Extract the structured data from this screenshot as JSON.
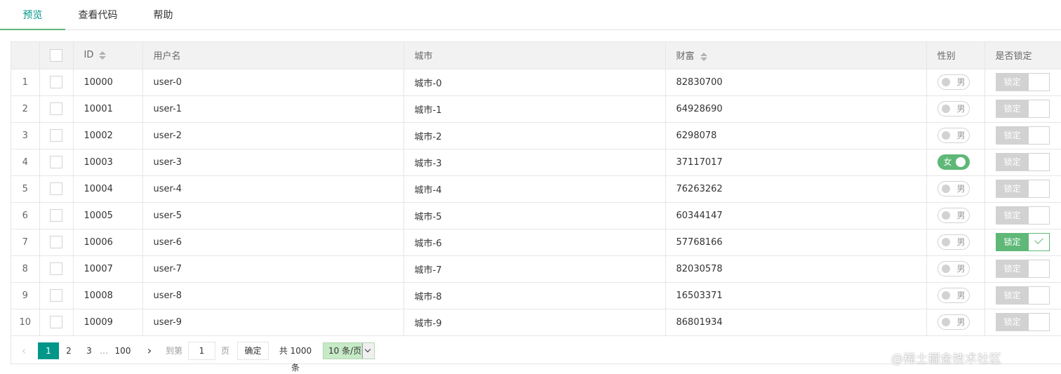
{
  "tabs": [
    {
      "label": "预览",
      "active": true
    },
    {
      "label": "查看代码",
      "active": false
    },
    {
      "label": "帮助",
      "active": false
    }
  ],
  "table": {
    "columns": {
      "id": "ID",
      "username": "用户名",
      "city": "城市",
      "wealth": "财富",
      "gender": "性别",
      "locked": "是否锁定"
    },
    "rows": [
      {
        "no": "1",
        "id": "10000",
        "username": "user-0",
        "city": "城市-0",
        "wealth": "82830700",
        "gender": "男",
        "gender_on": false,
        "lock_label": "锁定",
        "locked": false
      },
      {
        "no": "2",
        "id": "10001",
        "username": "user-1",
        "city": "城市-1",
        "wealth": "64928690",
        "gender": "男",
        "gender_on": false,
        "lock_label": "锁定",
        "locked": false
      },
      {
        "no": "3",
        "id": "10002",
        "username": "user-2",
        "city": "城市-2",
        "wealth": "6298078",
        "gender": "男",
        "gender_on": false,
        "lock_label": "锁定",
        "locked": false
      },
      {
        "no": "4",
        "id": "10003",
        "username": "user-3",
        "city": "城市-3",
        "wealth": "37117017",
        "gender": "女",
        "gender_on": true,
        "lock_label": "锁定",
        "locked": false
      },
      {
        "no": "5",
        "id": "10004",
        "username": "user-4",
        "city": "城市-4",
        "wealth": "76263262",
        "gender": "男",
        "gender_on": false,
        "lock_label": "锁定",
        "locked": false
      },
      {
        "no": "6",
        "id": "10005",
        "username": "user-5",
        "city": "城市-5",
        "wealth": "60344147",
        "gender": "男",
        "gender_on": false,
        "lock_label": "锁定",
        "locked": false
      },
      {
        "no": "7",
        "id": "10006",
        "username": "user-6",
        "city": "城市-6",
        "wealth": "57768166",
        "gender": "男",
        "gender_on": false,
        "lock_label": "锁定",
        "locked": true
      },
      {
        "no": "8",
        "id": "10007",
        "username": "user-7",
        "city": "城市-7",
        "wealth": "82030578",
        "gender": "男",
        "gender_on": false,
        "lock_label": "锁定",
        "locked": false
      },
      {
        "no": "9",
        "id": "10008",
        "username": "user-8",
        "city": "城市-8",
        "wealth": "16503371",
        "gender": "男",
        "gender_on": false,
        "lock_label": "锁定",
        "locked": false
      },
      {
        "no": "10",
        "id": "10009",
        "username": "user-9",
        "city": "城市-9",
        "wealth": "86801934",
        "gender": "男",
        "gender_on": false,
        "lock_label": "锁定",
        "locked": false
      }
    ]
  },
  "pager": {
    "prev": "‹",
    "pages": [
      "1",
      "2",
      "3"
    ],
    "ellipsis": "…",
    "last": "100",
    "next": "›",
    "goto_label": "到第",
    "goto_value": "1",
    "page_unit": "页",
    "confirm": "确定",
    "total": "共 1000 条",
    "page_size": "10 条/页"
  },
  "watermark": "@稀土掘金技术社区",
  "colors": {
    "accent": "#009688",
    "switch_on": "#5FB878",
    "border": "#e6e6e6",
    "header_bg": "#f2f2f2"
  }
}
